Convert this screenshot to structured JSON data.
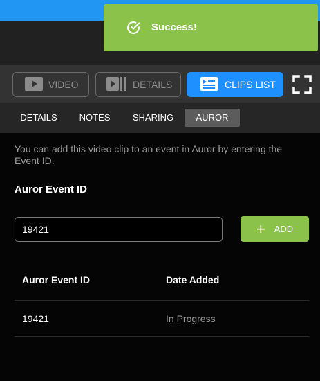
{
  "toolbar": {
    "video_label": "VIDEO",
    "details_label": "DETAILS",
    "clips_list_label": "CLIPS LIST"
  },
  "tabs": [
    {
      "label": "DETAILS",
      "active": false
    },
    {
      "label": "NOTES",
      "active": false
    },
    {
      "label": "SHARING",
      "active": false
    },
    {
      "label": "AUROR",
      "active": true
    }
  ],
  "auror": {
    "intro_text": "You can add this video clip to an event in Auror by entering the Event ID.",
    "field_label": "Auror Event ID",
    "input_value": "19421",
    "add_button_label": "ADD",
    "table": {
      "columns": [
        "Auror Event ID",
        "Date Added"
      ],
      "rows": [
        [
          "19421",
          "In Progress"
        ]
      ]
    }
  },
  "toast": {
    "message": "Success!"
  },
  "colors": {
    "accent_blue": "#1e90ff",
    "success_green": "#8bc34a"
  }
}
